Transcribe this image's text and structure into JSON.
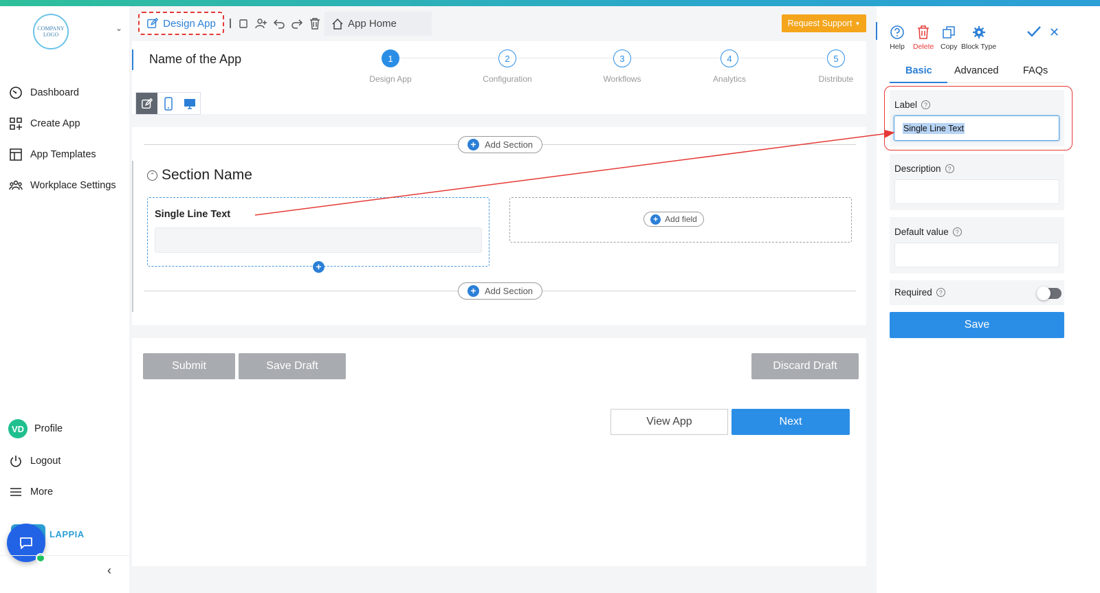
{
  "sidebar": {
    "logo_text": "COMPANY LOGO",
    "items": [
      {
        "label": "Dashboard",
        "icon": "gauge-icon"
      },
      {
        "label": "Create App",
        "icon": "grid-plus-icon"
      },
      {
        "label": "App Templates",
        "icon": "template-icon"
      },
      {
        "label": "Workplace Settings",
        "icon": "users-group-icon"
      }
    ],
    "bottom_items": [
      {
        "label": "Profile",
        "avatar": "VD"
      },
      {
        "label": "Logout",
        "icon": "power-icon"
      },
      {
        "label": "More",
        "icon": "menu-icon"
      }
    ],
    "brand": "LAPPIA"
  },
  "toolbar": {
    "design_tab": "Design App",
    "app_home": "App Home",
    "request_support": "Request Support"
  },
  "header": {
    "app_name": "Name of the App",
    "steps": [
      {
        "num": "1",
        "label": "Design App",
        "active": true
      },
      {
        "num": "2",
        "label": "Configuration",
        "active": false
      },
      {
        "num": "3",
        "label": "Workflows",
        "active": false
      },
      {
        "num": "4",
        "label": "Analytics",
        "active": false
      },
      {
        "num": "5",
        "label": "Distribute",
        "active": false
      }
    ]
  },
  "canvas": {
    "add_section_label": "Add Section",
    "section_name": "Section Name",
    "field_label": "Single Line Text",
    "add_field_label": "Add field"
  },
  "actions": {
    "submit": "Submit",
    "save_draft": "Save Draft",
    "discard_draft": "Discard Draft",
    "view_app": "View App",
    "next": "Next"
  },
  "panel": {
    "tools": [
      {
        "label": "Help",
        "icon": "help-icon"
      },
      {
        "label": "Delete",
        "icon": "trash-icon"
      },
      {
        "label": "Copy",
        "icon": "copy-icon"
      },
      {
        "label": "Block Type",
        "icon": "gear-icon"
      }
    ],
    "tabs": [
      "Basic",
      "Advanced",
      "FAQs"
    ],
    "label_title": "Label",
    "label_value": "Single Line Text",
    "description_title": "Description",
    "default_value_title": "Default value",
    "required_title": "Required",
    "required_on": false,
    "save": "Save"
  },
  "colors": {
    "accent": "#2b8ee6",
    "support": "#f4a51c",
    "annotation": "#e53935"
  }
}
